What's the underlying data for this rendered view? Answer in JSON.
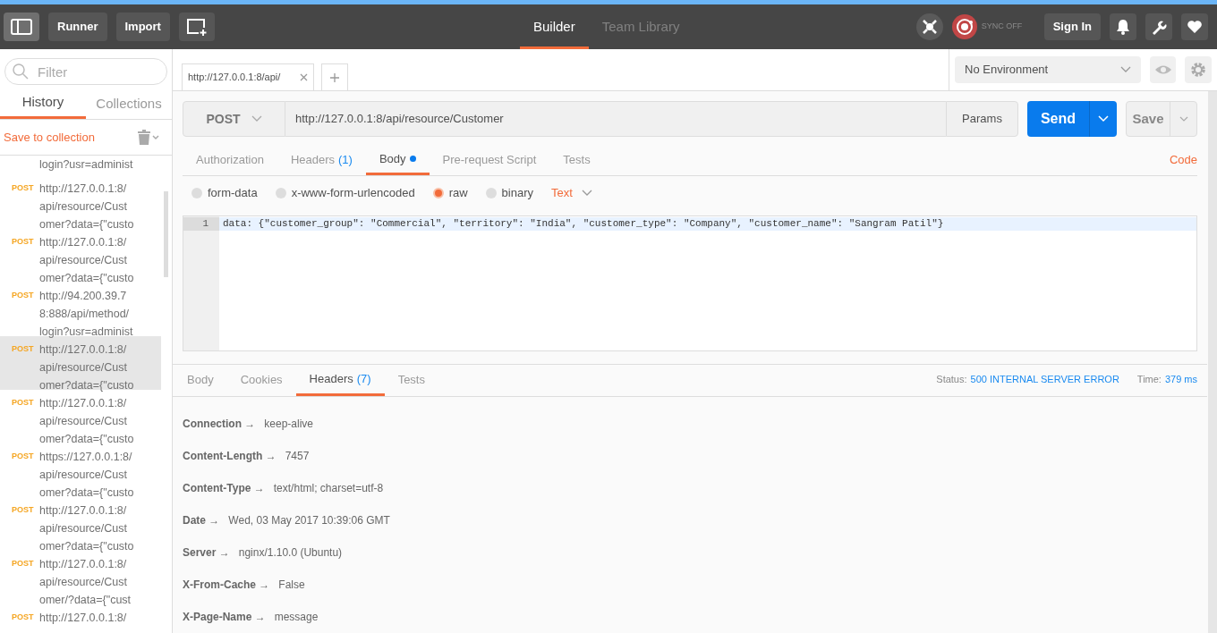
{
  "header": {
    "buttons": [
      "Runner",
      "Import"
    ],
    "nav": [
      {
        "label": "Builder",
        "selected": true
      },
      {
        "label": "Team Library",
        "selected": false
      }
    ],
    "sync": "SYNC OFF",
    "sign_in": "Sign In"
  },
  "sidebar": {
    "filter_placeholder": "Filter",
    "tabs": [
      {
        "label": "History",
        "selected": true
      },
      {
        "label": "Collections",
        "selected": false
      }
    ],
    "save_to_collection": "Save to collection",
    "history": [
      {
        "lines": [
          "login?usr=administ"
        ],
        "selected": false
      },
      {
        "method": "POST",
        "lines": [
          "http://127.0.0.1:8/",
          "api/resource/Cust",
          "omer?data={\"custo"
        ],
        "selected": false
      },
      {
        "method": "POST",
        "lines": [
          "http://127.0.0.1:8/",
          "api/resource/Cust",
          "omer?data={\"custo"
        ],
        "selected": false
      },
      {
        "method": "POST",
        "lines": [
          "http://94.200.39.7",
          "8:888/api/method/",
          "login?usr=administ"
        ],
        "selected": false
      },
      {
        "method": "POST",
        "lines": [
          "http://127.0.0.1:8/",
          "api/resource/Cust",
          "omer?data={\"custo"
        ],
        "selected": true
      },
      {
        "method": "POST",
        "lines": [
          "http://127.0.0.1:8/",
          "api/resource/Cust",
          "omer?data={\"custo"
        ],
        "selected": false
      },
      {
        "method": "POST",
        "lines": [
          "https://127.0.0.1:8/",
          "api/resource/Cust",
          "omer?data={\"custo"
        ],
        "selected": false
      },
      {
        "method": "POST",
        "lines": [
          "http://127.0.0.1:8/",
          "api/resource/Cust",
          "omer?data={\"custo"
        ],
        "selected": false
      },
      {
        "method": "POST",
        "lines": [
          "http://127.0.0.1:8/",
          "api/resource/Cust",
          "omer/?data={\"cust"
        ],
        "selected": false
      },
      {
        "method": "POST",
        "lines": [
          "http://127.0.0.1:8/"
        ],
        "selected": false
      }
    ]
  },
  "request_tab": {
    "label": "http://127.0.0.1:8/api/"
  },
  "environment": "No Environment",
  "request": {
    "method": "POST",
    "url": "http://127.0.0.1:8/api/resource/Customer",
    "params": "Params",
    "send": "Send",
    "save": "Save"
  },
  "request_tabs": [
    {
      "label": "Authorization",
      "selected": false,
      "modified": false
    },
    {
      "label": "Headers",
      "count": "(1)",
      "selected": false,
      "modified": false
    },
    {
      "label": "Body",
      "selected": true,
      "modified": true
    },
    {
      "label": "Pre-request Script",
      "selected": false,
      "modified": false
    },
    {
      "label": "Tests",
      "selected": false,
      "modified": false
    }
  ],
  "code_link": "Code",
  "body_types": [
    {
      "label": "form-data",
      "selected": false
    },
    {
      "label": "x-www-form-urlencoded",
      "selected": false
    },
    {
      "label": "raw",
      "selected": true
    },
    {
      "label": "binary",
      "selected": false
    }
  ],
  "raw_format": "Text",
  "editor": {
    "lines": [
      {
        "number": "1",
        "text": "data: {\"customer_group\": \"Commercial\", \"territory\": \"India\", \"customer_type\": \"Company\", \"customer_name\": \"Sangram Patil\"}"
      }
    ]
  },
  "response_tabs": [
    {
      "label": "Body",
      "selected": false
    },
    {
      "label": "Cookies",
      "selected": false
    },
    {
      "label": "Headers",
      "count": "(7)",
      "selected": true
    },
    {
      "label": "Tests",
      "selected": false
    }
  ],
  "status": {
    "label": "Status:",
    "value": "500 INTERNAL SERVER ERROR",
    "time_label": "Time:",
    "time_value": "379 ms"
  },
  "response_headers": [
    {
      "key": "Connection →",
      "value": "keep-alive"
    },
    {
      "key": "Content-Length →",
      "value": "7457"
    },
    {
      "key": "Content-Type →",
      "value": "text/html; charset=utf-8"
    },
    {
      "key": "Date →",
      "value": "Wed, 03 May 2017 10:39:06 GMT"
    },
    {
      "key": "Server →",
      "value": "nginx/1.10.0 (Ubuntu)"
    },
    {
      "key": "X-From-Cache →",
      "value": "False"
    },
    {
      "key": "X-Page-Name →",
      "value": "message"
    }
  ]
}
